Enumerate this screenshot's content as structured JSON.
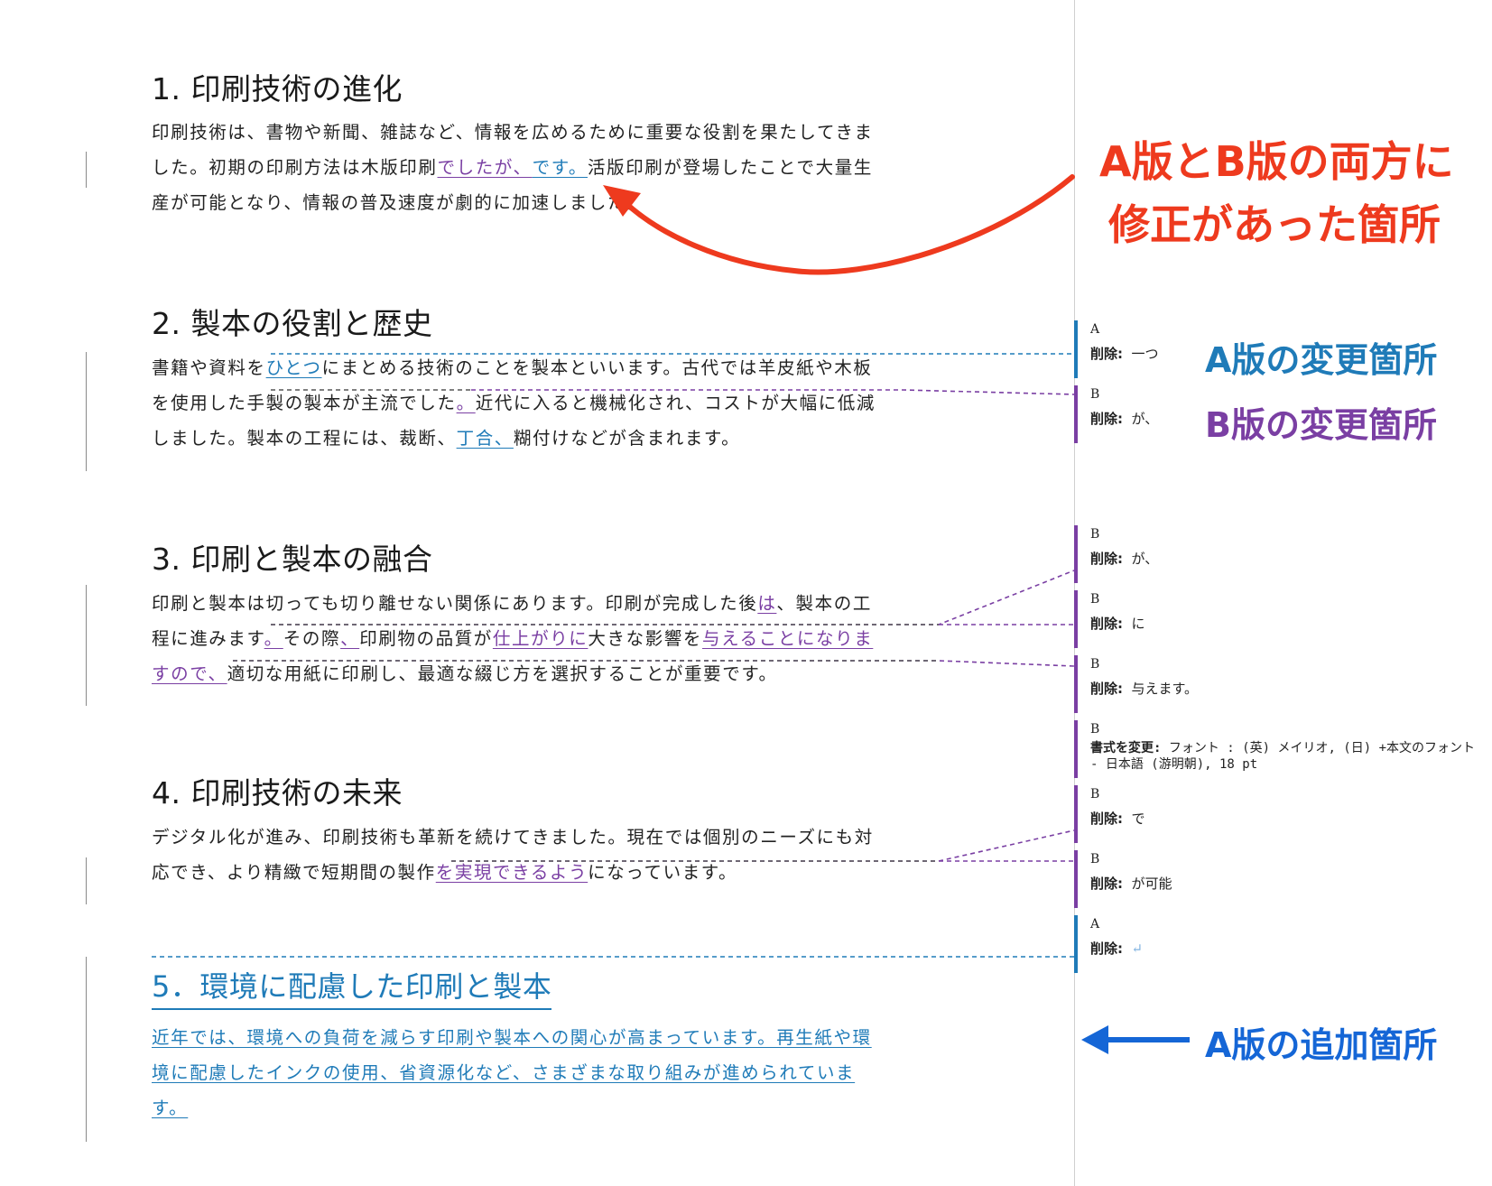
{
  "document": {
    "sections": [
      {
        "heading": "1. 印刷技術の進化",
        "lines": [
          [
            {
              "t": "印刷技術は、書物や新聞、雑誌など、情報を広めるために重要な役割を果たしてきま"
            }
          ],
          [
            {
              "t": "した。初期の印刷方法は木版印刷"
            },
            {
              "t": "でしたが、",
              "c": "insB"
            },
            {
              "t": "です。",
              "c": "insA"
            },
            {
              "t": "活版印刷が登場したことで大量生"
            }
          ],
          [
            {
              "t": "産が可能となり、情報の普及速度が劇的に加速しました。"
            }
          ]
        ]
      },
      {
        "heading": "2. 製本の役割と歴史",
        "lines": [
          [
            {
              "t": "書籍や資料を"
            },
            {
              "t": "ひとつ",
              "c": "insA"
            },
            {
              "t": "にまとめる技術のことを製本といいます。古代では羊皮紙や木板"
            }
          ],
          [
            {
              "t": "を使用した手製の製本が主流でした"
            },
            {
              "t": "。",
              "c": "insB"
            },
            {
              "t": "近代に入ると機械化され、コストが大幅に低減"
            }
          ],
          [
            {
              "t": "しました。製本の工程には、裁断、"
            },
            {
              "t": "丁合、",
              "c": "insA"
            },
            {
              "t": "糊付けなどが含まれます。"
            }
          ]
        ]
      },
      {
        "heading": "3. 印刷と製本の融合",
        "lines": [
          [
            {
              "t": "印刷と製本は切っても切り離せない関係にあります。印刷が完成した後"
            },
            {
              "t": "は",
              "c": "insB"
            },
            {
              "t": "、製本の工"
            }
          ],
          [
            {
              "t": "程に進みます"
            },
            {
              "t": "。",
              "c": "insB"
            },
            {
              "t": "その際"
            },
            {
              "t": "、",
              "c": "insB"
            },
            {
              "t": "印刷物の品質が"
            },
            {
              "t": "仕上がりに",
              "c": "insB"
            },
            {
              "t": "大きな影響を"
            },
            {
              "t": "与えることになりま",
              "c": "insB"
            }
          ],
          [
            {
              "t": "すので、",
              "c": "insB"
            },
            {
              "t": "適切な用紙に印刷し、最適な綴じ方を選択することが重要です。"
            }
          ]
        ]
      },
      {
        "heading": "4. 印刷技術の未来",
        "lines": [
          [
            {
              "t": "デジタル化が進み、印刷技術も革新を続けてきました。現在では個別のニーズにも対"
            }
          ],
          [
            {
              "t": "応でき、より精緻で短期間の製作"
            },
            {
              "t": "を実現できるよう",
              "c": "insB"
            },
            {
              "t": "になっています。"
            }
          ]
        ]
      }
    ],
    "added_section": {
      "heading": "5．環境に配慮した印刷と製本",
      "lines": [
        "近年では、環境への負荷を減らす印刷や製本への関心が高まっています。再生紙や環",
        "境に配慮したインクの使用、省資源化など、さまざまな取り組みが進められていま",
        "す。"
      ]
    }
  },
  "revisions": [
    {
      "author": "A",
      "label": "削除:",
      "value": "一つ",
      "color": "#1f7bb8"
    },
    {
      "author": "B",
      "label": "削除:",
      "value": "が、",
      "color": "#7a3fa3"
    },
    {
      "author": "B",
      "label": "削除:",
      "value": "が、",
      "color": "#7a3fa3"
    },
    {
      "author": "B",
      "label": "削除:",
      "value": "に",
      "color": "#7a3fa3"
    },
    {
      "author": "B",
      "label": "削除:",
      "value": "与えます。",
      "color": "#7a3fa3"
    },
    {
      "author": "B",
      "label": "書式を変更:",
      "value": "フォント : (英) メイリオ, (日) +本文のフォント - 日本語 (游明朝), 18 pt",
      "color": "#7a3fa3"
    },
    {
      "author": "B",
      "label": "削除:",
      "value": "で",
      "color": "#7a3fa3"
    },
    {
      "author": "B",
      "label": "削除:",
      "value": "が可能",
      "color": "#7a3fa3"
    },
    {
      "author": "A",
      "label": "削除:",
      "value": "↵",
      "color": "#1f7bb8"
    }
  ],
  "annotations": {
    "both_versions_line1": "A版とB版の両方に",
    "both_versions_line2": "修正があった箇所",
    "a_changes": "A版の変更箇所",
    "b_changes": "B版の変更箇所",
    "a_additions": "A版の追加箇所"
  },
  "colors": {
    "version_a": "#1f7bb8",
    "version_b": "#7a3fa3",
    "highlight_red": "#ee3a1e",
    "arrow_blue": "#1566d6"
  }
}
